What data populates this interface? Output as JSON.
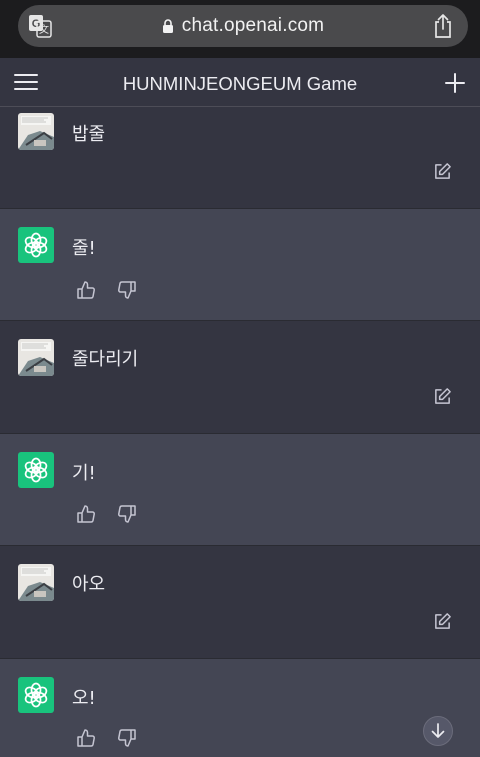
{
  "browser": {
    "url": "chat.openai.com",
    "icons": [
      "translate-icon",
      "lock-icon",
      "share-icon"
    ]
  },
  "header": {
    "title": "HUNMINJEONGEUM Game",
    "icons": [
      "menu-icon",
      "plus-icon"
    ]
  },
  "messages": [
    {
      "role": "user",
      "text": "밥줄"
    },
    {
      "role": "assistant",
      "text": "줄!"
    },
    {
      "role": "user",
      "text": "줄다리기"
    },
    {
      "role": "assistant",
      "text": "기!"
    },
    {
      "role": "user",
      "text": "아오"
    },
    {
      "role": "assistant",
      "text": "오!"
    }
  ],
  "colors": {
    "user_bg": "#343541",
    "assistant_bg": "#444654",
    "assistant_avatar": "#19c37d"
  }
}
